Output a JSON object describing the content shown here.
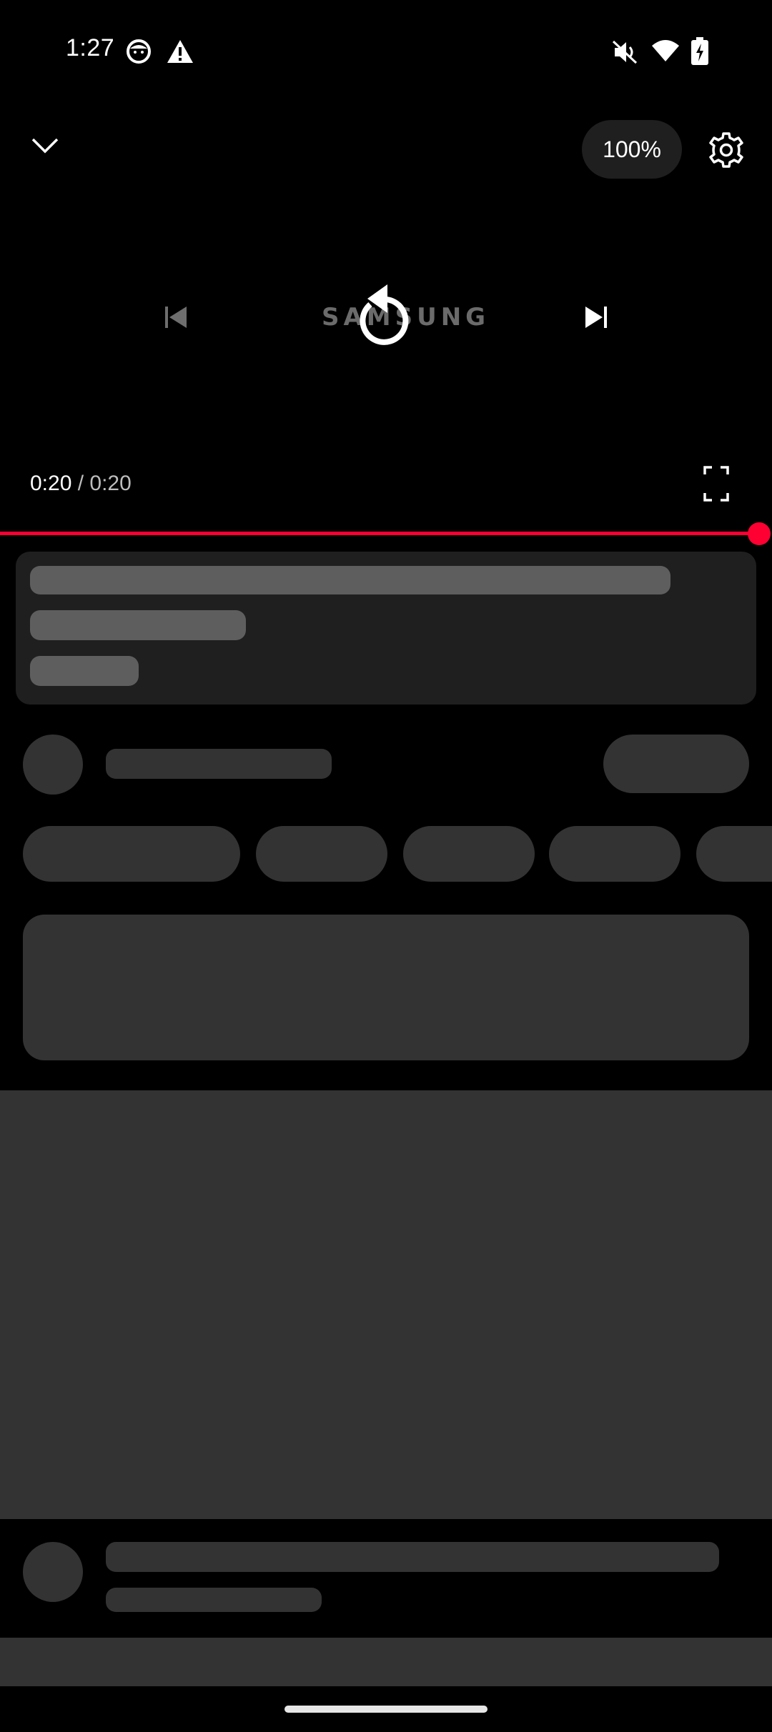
{
  "status_bar": {
    "time": "1:27",
    "icons": [
      "face-icon",
      "warning-icon",
      "mute-icon",
      "wifi-icon",
      "battery-charging-icon"
    ]
  },
  "player": {
    "zoom_label": "100%",
    "brand_text": "SAMSUNG",
    "current_time": "0:20",
    "separator": " / ",
    "total_time": "0:20",
    "progress_fraction": 1.0,
    "accent_color": "#ff0033"
  }
}
